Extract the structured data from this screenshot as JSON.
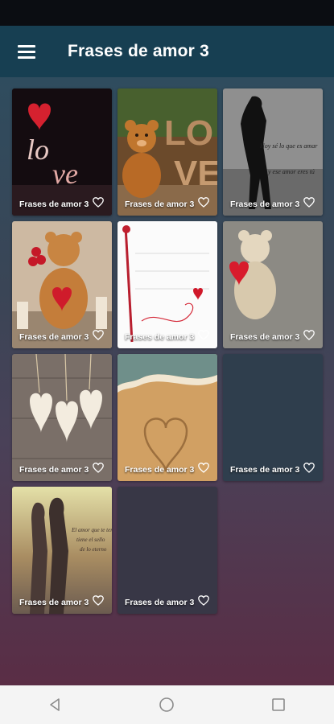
{
  "app_bar": {
    "title": "Frases de amor 3",
    "menu_icon": "hamburger-menu-icon"
  },
  "tiles": [
    {
      "caption": "Frases de amor 3",
      "image": "love-letters-heart"
    },
    {
      "caption": "Frases de amor 3",
      "image": "teddy-bear-love-sign"
    },
    {
      "caption": "Frases de amor 3",
      "image": "couple-silhouette-quote"
    },
    {
      "caption": "Frases de amor 3",
      "image": "teddy-bear-with-heart"
    },
    {
      "caption": "Frases de amor 3",
      "image": "handwritten-note-rose"
    },
    {
      "caption": "Frases de amor 3",
      "image": "teddy-bear-quote"
    },
    {
      "caption": "Frases de amor 3",
      "image": "wooden-hearts"
    },
    {
      "caption": "Frases de amor 3",
      "image": "heart-in-sand"
    },
    {
      "caption": "Frases de amor 3",
      "image": ""
    },
    {
      "caption": "Frases de amor 3",
      "image": "couple-sunset-quote"
    },
    {
      "caption": "Frases de amor 3",
      "image": ""
    }
  ],
  "nav": {
    "back_icon": "back-triangle-icon",
    "home_icon": "home-circle-icon",
    "recents_icon": "recents-square-icon"
  },
  "colors": {
    "app_bar": "#173f52",
    "nav_bar": "#f4f4f4"
  }
}
